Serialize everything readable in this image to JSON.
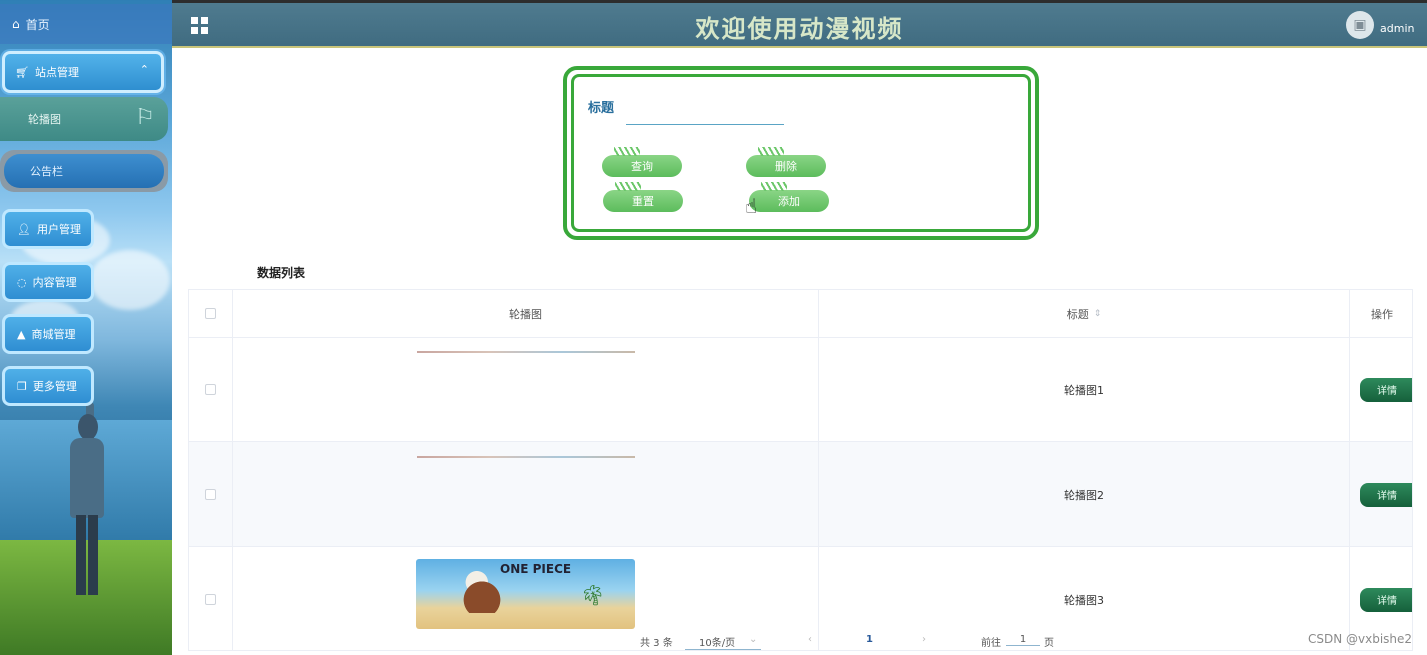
{
  "header": {
    "title": "欢迎使用动漫视频",
    "username": "admin"
  },
  "sidebar": {
    "home": "首页",
    "site_management": "站点管理",
    "sub_items": [
      "轮播图",
      "公告栏"
    ],
    "menus": [
      "用户管理",
      "内容管理",
      "商城管理",
      "更多管理"
    ]
  },
  "search": {
    "title_label": "标题",
    "title_value": "",
    "buttons": {
      "query": "查询",
      "delete": "删除",
      "reset": "重置",
      "add": "添加"
    }
  },
  "list": {
    "title": "数据列表",
    "columns": {
      "image": "轮播图",
      "title": "标题",
      "title_sort": "⇕",
      "action": "操作"
    },
    "rows": [
      {
        "title": "轮播图1",
        "action": "详情"
      },
      {
        "title": "轮播图2",
        "action": "详情"
      },
      {
        "title": "轮播图3",
        "action": "详情"
      }
    ],
    "thumb3_text": "ONE PIECE"
  },
  "pagination": {
    "total": "共 3 条",
    "page_size": "10条/页",
    "current_page": "1",
    "goto_label": "前往",
    "goto_value": "1",
    "page_unit": "页"
  },
  "watermark": "CSDN @vxbishe2"
}
